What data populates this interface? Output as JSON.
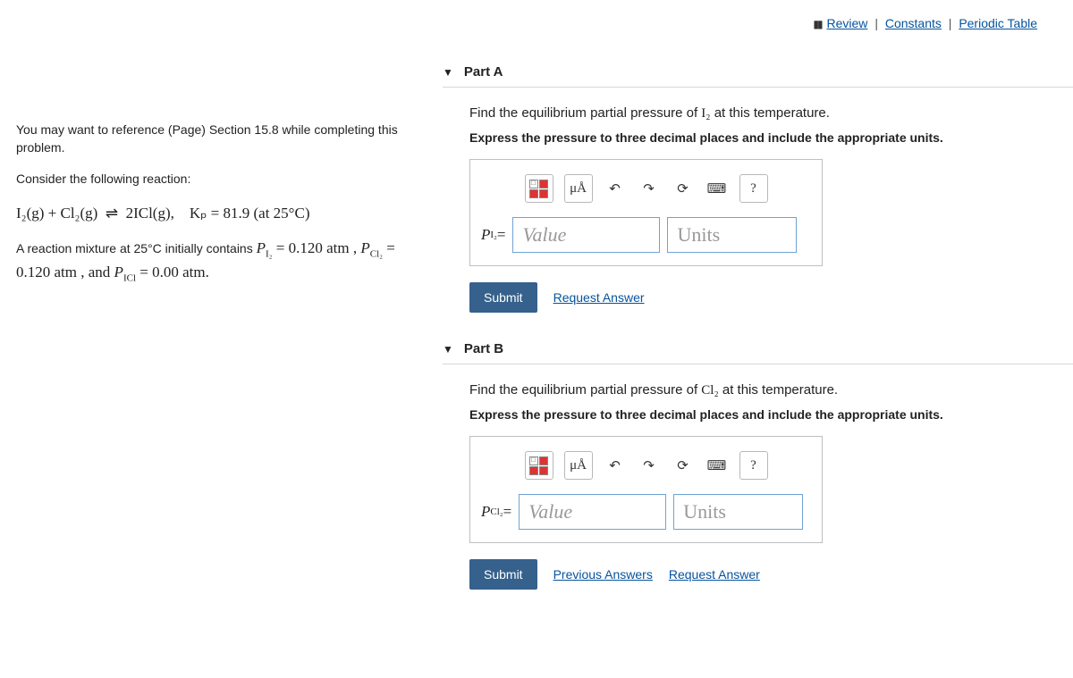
{
  "toplinks": {
    "review": "Review",
    "constants": "Constants",
    "periodic": "Periodic Table"
  },
  "hint": {
    "ref": "You may want to reference (Page) Section 15.8 while completing this problem.",
    "consider": "Consider the following reaction:",
    "eqn_lhs": "I₂(g) + Cl₂(g)",
    "eqn_arrow": "⇌",
    "eqn_rhs": "2ICl(g),",
    "eqn_kp": "Kₚ = 81.9 (at 25°C)",
    "cond1": "A reaction mixture at 25°C initially contains ",
    "pcond_i2": "P",
    "pcond_i2_sub": "I₂",
    "pcond_i2_val": " = 0.120 atm , ",
    "pcond_cl2": "P",
    "pcond_cl2_sub": "Cl₂",
    "pcond_cl2_val": " = 0.120 atm , and ",
    "pcond_icl": "P",
    "pcond_icl_sub": "ICl",
    "pcond_icl_val": " = 0.00 atm."
  },
  "parts": {
    "a": {
      "title": "Part A",
      "prompt_pre": "Find the equilibrium partial pressure of ",
      "prompt_sym": "I₂",
      "prompt_post": " at this temperature.",
      "instructions": "Express the pressure to three decimal places and include the appropriate units.",
      "prefix": "P",
      "prefsub": "I₂",
      "eq": " = ",
      "value_ph": "Value",
      "units_ph": "Units",
      "submit": "Submit",
      "request": "Request Answer"
    },
    "b": {
      "title": "Part B",
      "prompt_pre": "Find the equilibrium partial pressure of ",
      "prompt_sym": "Cl₂",
      "prompt_post": " at this temperature.",
      "instructions": "Express the pressure to three decimal places and include the appropriate units.",
      "prefix": "P",
      "prefsub": "Cl₂",
      "eq": " = ",
      "value_ph": "Value",
      "units_ph": "Units",
      "submit": "Submit",
      "prev": "Previous Answers",
      "request": "Request Answer"
    }
  },
  "toolbar": {
    "templates": "⠿",
    "special": "μÅ",
    "undo": "↶",
    "redo": "↷",
    "reset": "⟳",
    "keyboard": "⌨",
    "help": "?"
  }
}
